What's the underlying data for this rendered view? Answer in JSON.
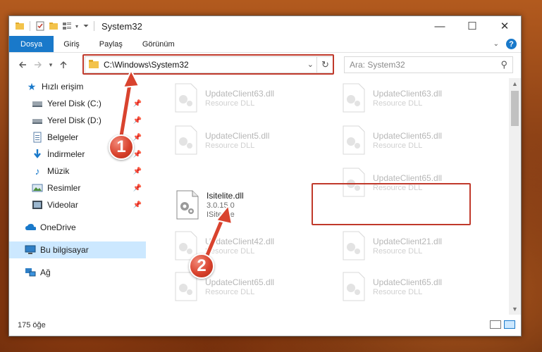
{
  "window": {
    "title": "System32"
  },
  "titlebar": {
    "minimize": "—",
    "maximize": "☐",
    "close": "✕"
  },
  "ribbon": {
    "tabs": [
      "Dosya",
      "Giriş",
      "Paylaş",
      "Görünüm"
    ]
  },
  "nav": {
    "path": "C:\\Windows\\System32",
    "search_placeholder": "Ara: System32"
  },
  "sidebar": {
    "quick_access": "Hızlı erişim",
    "items": [
      {
        "label": "Yerel Disk (C:)",
        "icon": "drive-icon"
      },
      {
        "label": "Yerel Disk (D:)",
        "icon": "drive-icon"
      },
      {
        "label": "Belgeler",
        "icon": "documents-icon"
      },
      {
        "label": "İndirmeler",
        "icon": "downloads-icon"
      },
      {
        "label": "Müzik",
        "icon": "music-icon"
      },
      {
        "label": "Resimler",
        "icon": "pictures-icon"
      },
      {
        "label": "Videolar",
        "icon": "videos-icon"
      }
    ],
    "onedrive": "OneDrive",
    "this_pc": "Bu bilgisayar",
    "network": "Ağ"
  },
  "files": {
    "col1": [
      {
        "name": "UpdateClient63.dll",
        "desc": "Resource DLL"
      },
      {
        "name": "UpdateClient5.dll",
        "desc": "Resource DLL"
      },
      {
        "name": "Isitelite.dll",
        "version": "3.0.15.0",
        "desc": "ISiteLite"
      },
      {
        "name": "UpdateClient42.dll",
        "desc": "Resource DLL"
      },
      {
        "name": "UpdateClient65.dll",
        "desc": "Resource DLL"
      }
    ],
    "col2": [
      {
        "name": "UpdateClient63.dll",
        "desc": "Resource DLL"
      },
      {
        "name": "UpdateClient65.dll",
        "desc": "Resource DLL"
      },
      {
        "name": "UpdateClient65.dll",
        "desc": "Resource DLL"
      },
      {
        "name": "UpdateClient21.dll",
        "desc": "Resource DLL"
      },
      {
        "name": "UpdateClient65.dll",
        "desc": "Resource DLL"
      }
    ]
  },
  "status": {
    "count": "175 öğe"
  },
  "callouts": [
    "1",
    "2"
  ],
  "colors": {
    "accent": "#1979ca",
    "highlight": "#c0392b",
    "selected": "#cce8ff"
  }
}
